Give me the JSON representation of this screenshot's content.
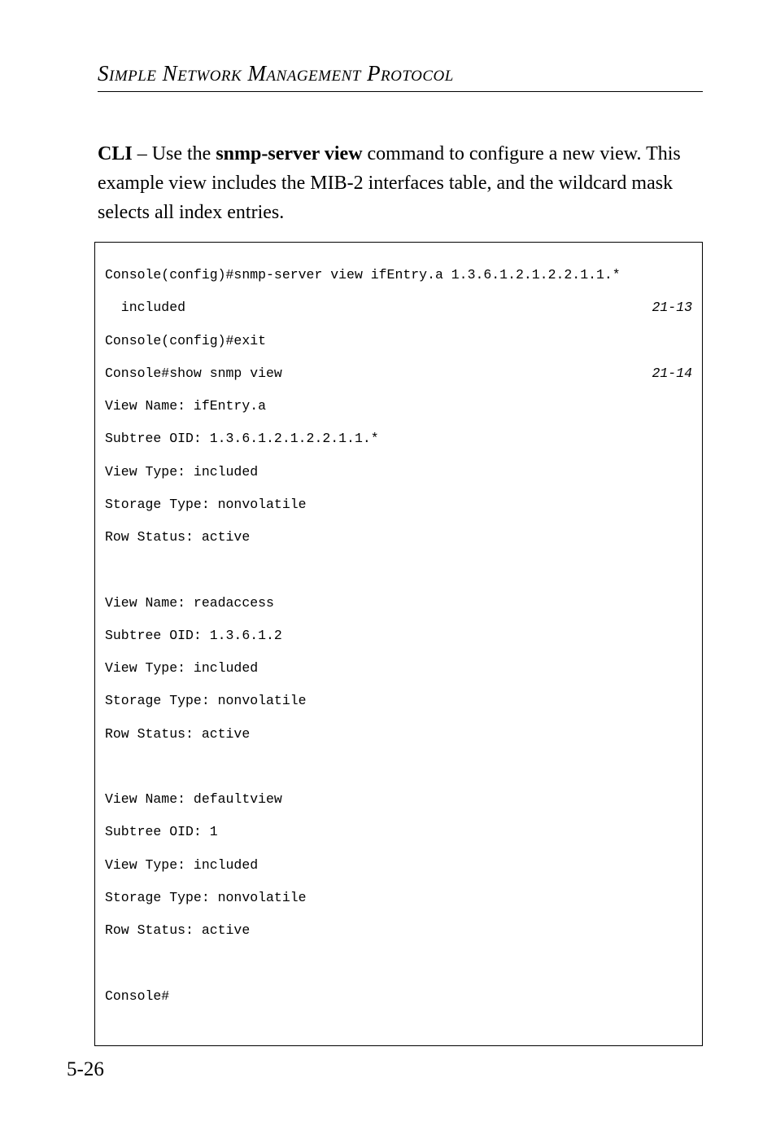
{
  "chapter_title": "Simple Network Management Protocol",
  "body": {
    "prefix": "CLI",
    "sep": " – Use the ",
    "cmd": "snmp-server view",
    "rest": " command to configure a new view. This example view includes the MIB-2 interfaces table, and the wildcard mask selects all index entries."
  },
  "code": {
    "l01": "Console(config)#snmp-server view ifEntry.a 1.3.6.1.2.1.2.2.1.1.*",
    "l02l": "  included",
    "l02r": "21-13",
    "l03": "Console(config)#exit",
    "l04l": "Console#show snmp view",
    "l04r": "21-14",
    "l05": "View Name: ifEntry.a",
    "l06": "Subtree OID: 1.3.6.1.2.1.2.2.1.1.*",
    "l07": "View Type: included",
    "l08": "Storage Type: nonvolatile",
    "l09": "Row Status: active",
    "l10": "",
    "l11": "View Name: readaccess",
    "l12": "Subtree OID: 1.3.6.1.2",
    "l13": "View Type: included",
    "l14": "Storage Type: nonvolatile",
    "l15": "Row Status: active",
    "l16": "",
    "l17": "View Name: defaultview",
    "l18": "Subtree OID: 1",
    "l19": "View Type: included",
    "l20": "Storage Type: nonvolatile",
    "l21": "Row Status: active",
    "l22": "",
    "l23": "Console#"
  },
  "page_number": "5-26"
}
